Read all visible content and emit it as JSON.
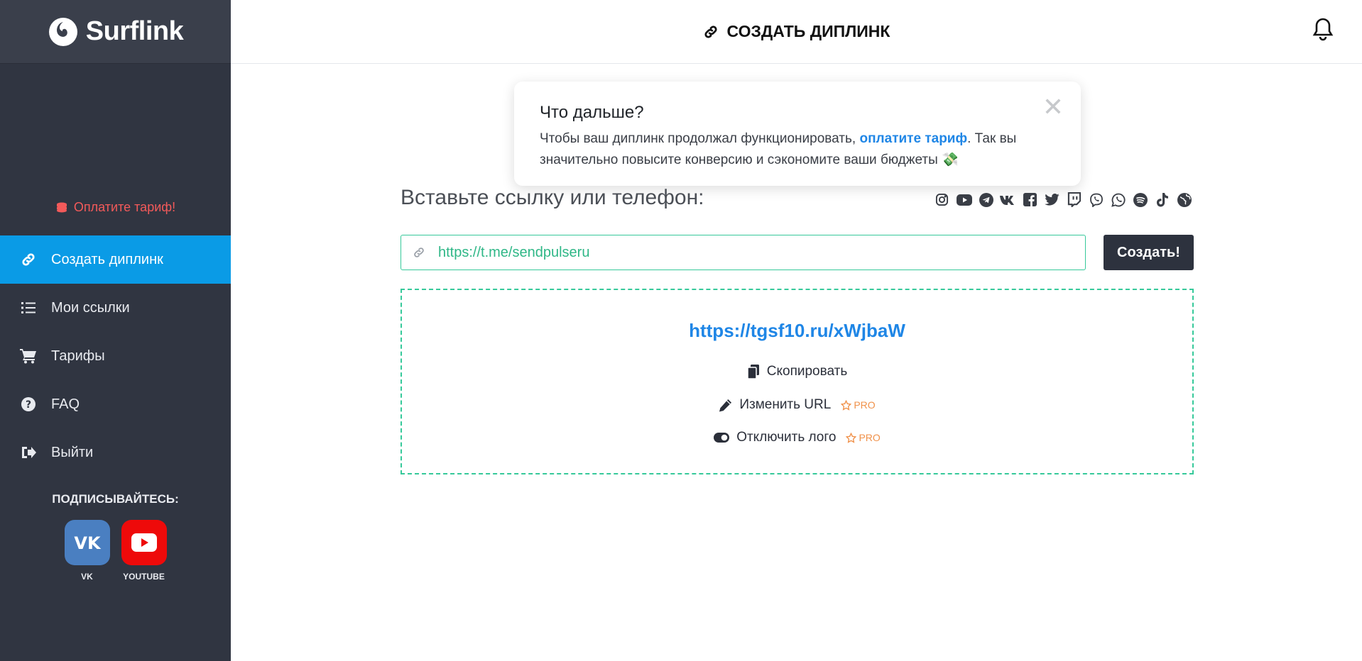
{
  "brand": {
    "name": "Surflink"
  },
  "sidebar": {
    "pay_link": "Оплатите тариф!",
    "items": [
      {
        "label": "Создать диплинк",
        "icon": "link-icon",
        "active": true
      },
      {
        "label": "Мои ссылки",
        "icon": "list-icon",
        "active": false
      },
      {
        "label": "Тарифы",
        "icon": "cart-icon",
        "active": false
      },
      {
        "label": "FAQ",
        "icon": "question-icon",
        "active": false
      },
      {
        "label": "Выйти",
        "icon": "sign-out-icon",
        "active": false
      }
    ],
    "subscribe_label": "ПОДПИСЫВАЙТЕСЬ:",
    "socials": [
      {
        "label": "VK",
        "color": "#4a7fc1"
      },
      {
        "label": "YOUTUBE",
        "color": "#ee0a0a"
      }
    ]
  },
  "header": {
    "title": "СОЗДАТЬ ДИПЛИНК"
  },
  "popup": {
    "title": "Что дальше?",
    "text_before": "Чтобы ваш диплинк продолжал функционировать, ",
    "link_text": "оплатите тариф",
    "text_after": ". Так вы значительно повысите конверсию и сэкономите ваши бюджеты 💸"
  },
  "form": {
    "input_label": "Вставьте ссылку или телефон:",
    "input_value": "https://t.me/sendpulseru",
    "create_label": "Создать!",
    "platforms": [
      "instagram-icon",
      "youtube-icon",
      "telegram-icon",
      "vk-icon",
      "facebook-icon",
      "twitter-icon",
      "twitch-icon",
      "viber-icon",
      "whatsapp-icon",
      "spotify-icon",
      "tiktok-icon",
      "globe-icon"
    ]
  },
  "result": {
    "short_link": "https://tgsf10.ru/xWjbaW",
    "copy_label": "Скопировать",
    "edit_label": "Изменить URL",
    "logo_label": "Отключить лого",
    "pro_label": "PRO"
  },
  "colors": {
    "accent": "#0a9be6",
    "success": "#36c99a",
    "link": "#1f86e6",
    "danger": "#f35a5a",
    "pro": "#f0914a"
  }
}
